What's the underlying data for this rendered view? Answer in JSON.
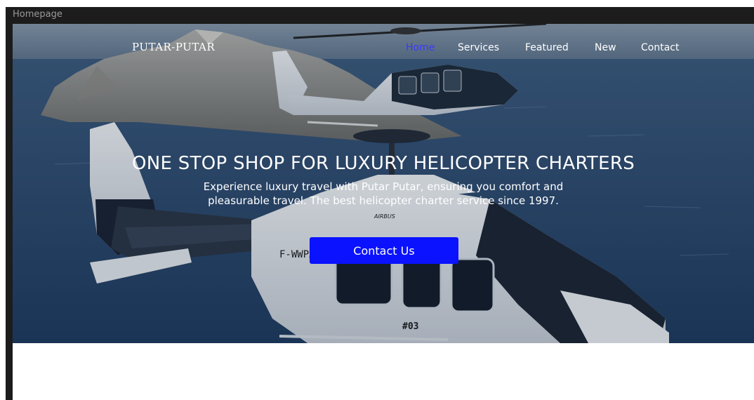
{
  "window": {
    "tab_title": "Homepage"
  },
  "brand": {
    "name": "PUTAR-PUTAR"
  },
  "nav": {
    "items": [
      {
        "label": "Home",
        "active": true
      },
      {
        "label": "Services",
        "active": false
      },
      {
        "label": "Featured",
        "active": false
      },
      {
        "label": "New",
        "active": false
      },
      {
        "label": "Contact",
        "active": false
      }
    ]
  },
  "hero": {
    "headline": "ONE STOP SHOP FOR LUXURY HELICOPTER CHARTERS",
    "subtext_line1": "Experience luxury travel with Putar Putar, ensuring you comfort and",
    "subtext_line2": "pleasurable travel. The best helicopter charter service since 1997.",
    "cta_label": "Contact Us",
    "heli_reg": "F-WWPA",
    "heli_number": "#03",
    "heli_maker": "AIRBUS"
  },
  "colors": {
    "frame": "#1c1c1c",
    "cta": "#0a12ff",
    "nav_active": "#3a3aff",
    "text": "#ffffff"
  }
}
